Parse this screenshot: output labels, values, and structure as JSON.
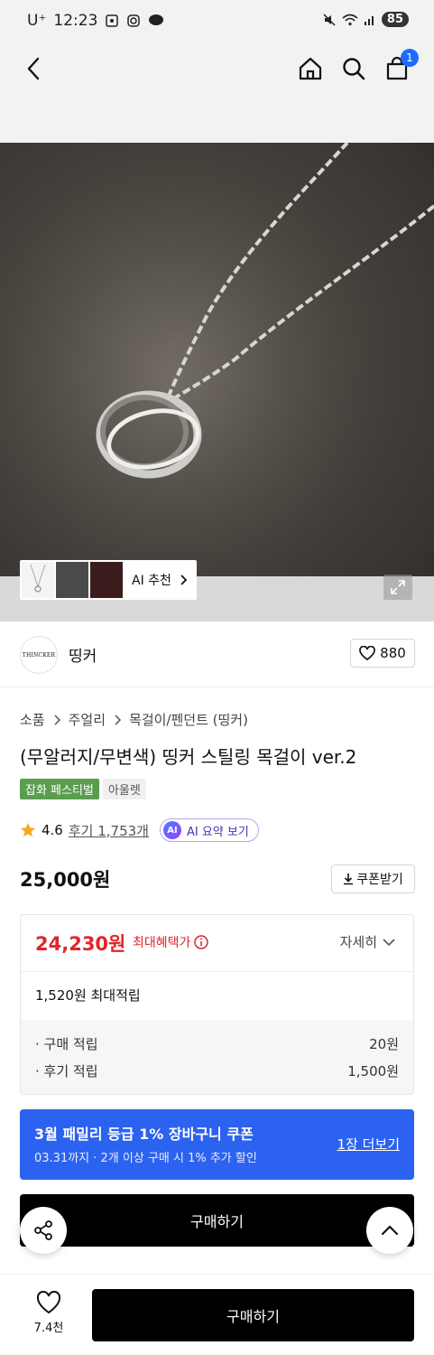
{
  "status_bar": {
    "carrier": "U⁺",
    "time": "12:23",
    "battery": "85"
  },
  "header": {
    "back_icon": "chevron-left-icon",
    "home_icon": "home-icon",
    "search_icon": "search-icon",
    "cart_icon": "shopping-bag-icon",
    "cart_count": "1"
  },
  "gallery": {
    "ai_recommend_label": "AI 추천",
    "zoom_icon": "expand-icon"
  },
  "brand": {
    "logo_text": "THINCKER",
    "name": "띵커",
    "like_count": "880"
  },
  "breadcrumb": [
    "소품",
    "주얼리",
    "목걸이/펜던트 (띵커)"
  ],
  "product": {
    "title": "(무알러지/무변색) 띵커 스틸링 목걸이 ver.2",
    "tags": [
      "잡화 페스티벌",
      "아울렛"
    ],
    "rating": "4.6",
    "reviews": "후기 1,753개",
    "ai_summary_badge": "AI",
    "ai_summary_label": "AI 요약 보기",
    "price": "25,000원",
    "coupon_button": "쿠폰받기"
  },
  "benefit": {
    "sale_price": "24,230원",
    "max_benefit_label": "최대혜택가",
    "detail_label": "자세히",
    "points_total": "1,520원 최대적립",
    "rows": [
      {
        "label": "· 구매 적립",
        "value": "20원"
      },
      {
        "label": "· 후기 적립",
        "value": "1,500원"
      }
    ]
  },
  "promo": {
    "title": "3월 패밀리 등급 1% 장바구니 쿠폰",
    "subtitle": "03.31까지 · 2개 이상 구매 시 1% 추가 할인",
    "more_label": "1장 더보기"
  },
  "actions": {
    "buy_label_inline": "구매하기",
    "like_count": "7.4천",
    "buy_label": "구매하기"
  },
  "colors": {
    "sale_red": "#e0262b",
    "promo_blue": "#2c62f0",
    "tag_green": "#5a9d4e",
    "cart_badge": "#1f6bff"
  }
}
